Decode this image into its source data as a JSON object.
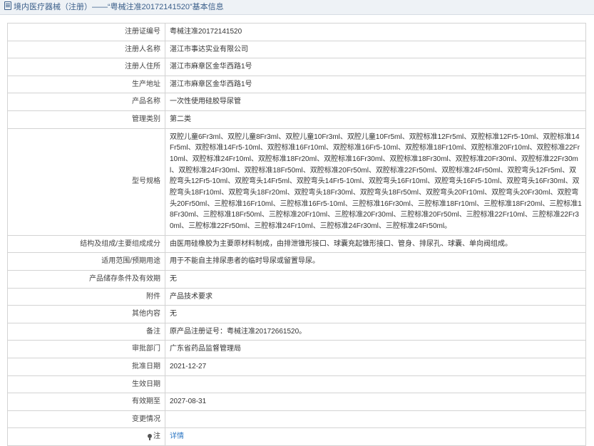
{
  "header": {
    "title": "境内医疗器械（注册）——“粤械注准20172141520”基本信息"
  },
  "rows": [
    {
      "label": "注册证编号",
      "value": "粤械注准20172141520"
    },
    {
      "label": "注册人名称",
      "value": "湛江市事达实业有限公司"
    },
    {
      "label": "注册人住所",
      "value": "湛江市麻章区金华西路1号"
    },
    {
      "label": "生产地址",
      "value": "湛江市麻章区金华西路1号"
    },
    {
      "label": "产品名称",
      "value": "一次性使用硅胶导尿管"
    },
    {
      "label": "管理类别",
      "value": "第二类"
    },
    {
      "label": "型号规格",
      "value": "双腔儿童6Fr3ml、双腔儿童8Fr3ml、双腔儿童10Fr3ml、双腔儿童10Fr5ml、双腔标准12Fr5ml、双腔标准12Fr5-10ml、双腔标准14Fr5ml、双腔标准14Fr5-10ml、双腔标准16Fr10ml、双腔标准16Fr5-10ml、双腔标准18Fr10ml、双腔标准20Fr10ml、双腔标准22Fr10ml、双腔标准24Fr10ml、双腔标准18Fr20ml、双腔标准16Fr30ml、双腔标准18Fr30ml、双腔标准20Fr30ml、双腔标准22Fr30ml、双腔标准24Fr30ml、双腔标准18Fr50ml、双腔标准20Fr50ml、双腔标准22Fr50ml、双腔标准24Fr50ml、双腔弯头12Fr5ml、双腔弯头12Fr5-10ml、双腔弯头14Fr5ml、双腔弯头14Fr5-10ml、双腔弯头16Fr10ml、双腔弯头16Fr5-10ml、双腔弯头16Fr30ml、双腔弯头18Fr10ml、双腔弯头18Fr20ml、双腔弯头18Fr30ml、双腔弯头18Fr50ml、双腔弯头20Fr10ml、双腔弯头20Fr30ml、双腔弯头20Fr50ml、三腔标准16Fr10ml、三腔标准16Fr5-10ml、三腔标准16Fr30ml、三腔标准18Fr10ml、三腔标准18Fr20ml、三腔标准18Fr30ml、三腔标准18Fr50ml、三腔标准20Fr10ml、三腔标准20Fr30ml、三腔标准20Fr50ml、三腔标准22Fr10ml、三腔标准22Fr30ml、三腔标准22Fr50ml、三腔标准24Fr10ml、三腔标准24Fr30ml、三腔标准24Fr50ml。"
    },
    {
      "label": "结构及组成/主要组成成分",
      "value": "由医用硅橡胶为主要原材料制成，由排泄锥形接口、球囊充起锥形接口、管身、排尿孔、球囊、单向阀组成。"
    },
    {
      "label": "适用范围/预期用途",
      "value": "用于不能自主排尿患者的临时导尿或留置导尿。"
    },
    {
      "label": "产品储存条件及有效期",
      "value": "无"
    },
    {
      "label": "附件",
      "value": "产品技术要求"
    },
    {
      "label": "其他内容",
      "value": "无"
    },
    {
      "label": "备注",
      "value": "原产品注册证号：粤械注准20172661520。"
    },
    {
      "label": "审批部门",
      "value": "广东省药品监督管理局"
    },
    {
      "label": "批准日期",
      "value": "2021-12-27"
    },
    {
      "label": "生效日期",
      "value": ""
    },
    {
      "label": "有效期至",
      "value": "2027-08-31"
    },
    {
      "label": "变更情况",
      "value": ""
    },
    {
      "label": "注",
      "value": "详情",
      "label_icon": "info-pin-icon"
    }
  ],
  "colors": {
    "title_text": "#3b5f8a",
    "title_bg": "#eef2f6",
    "border": "#d3d3d3",
    "link": "#2f78c4"
  }
}
